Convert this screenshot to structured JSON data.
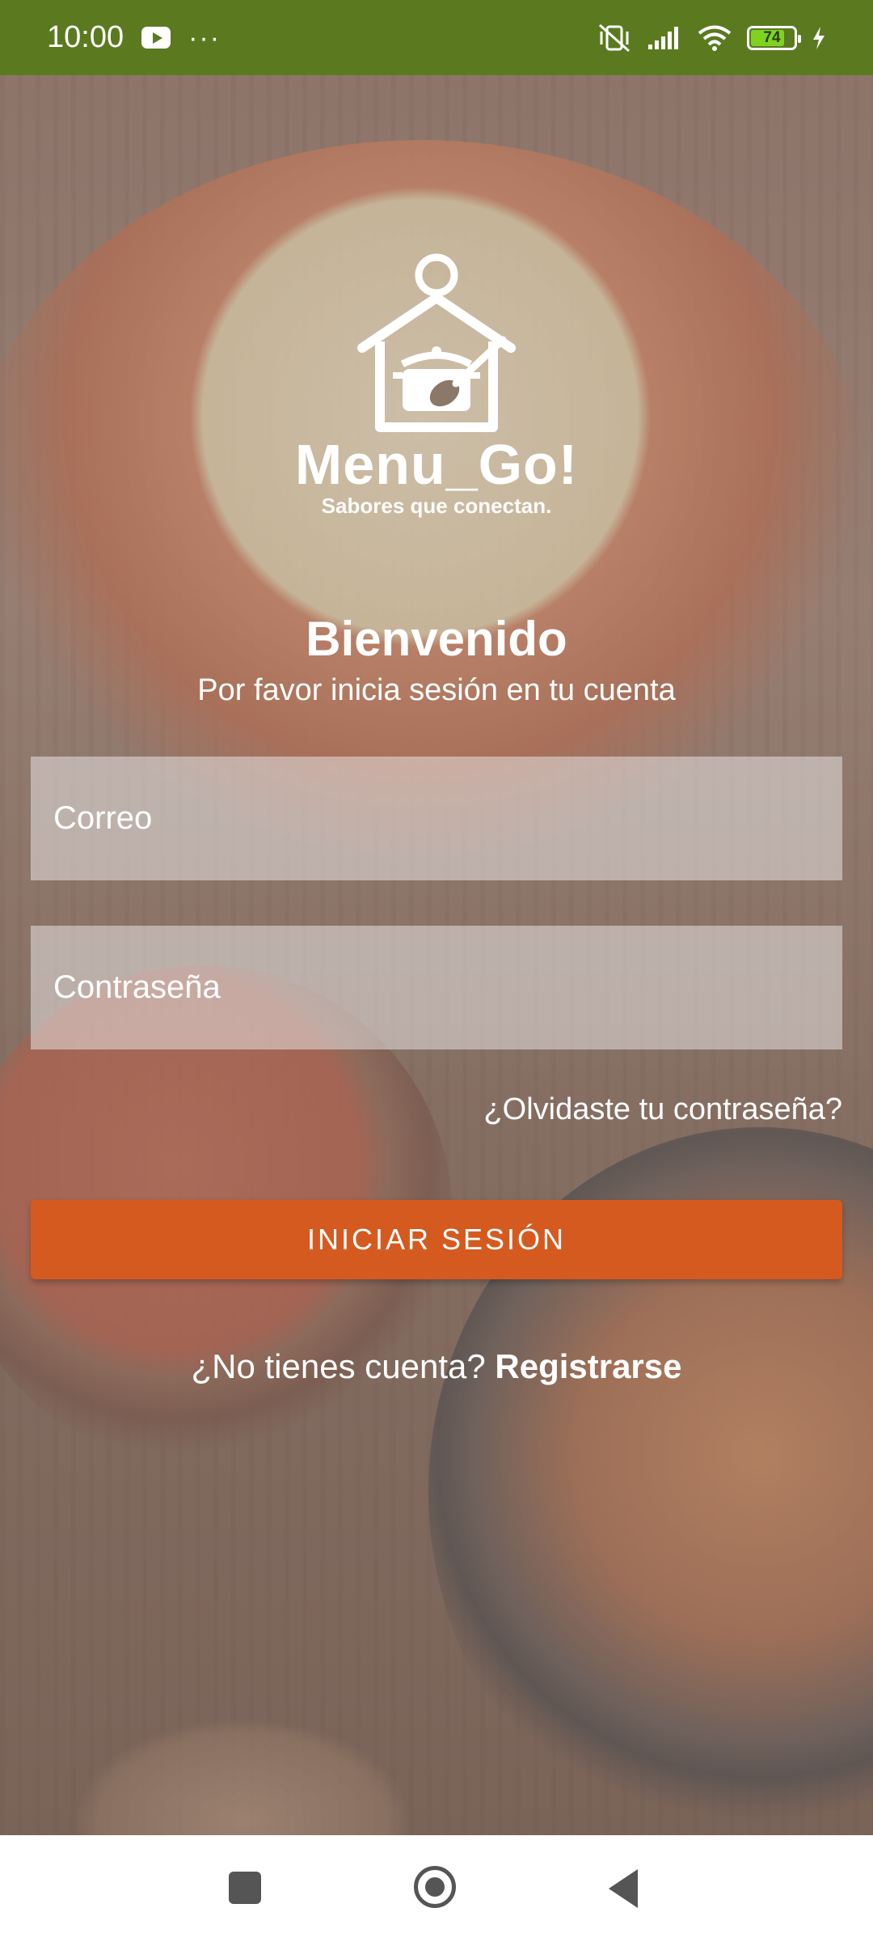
{
  "status_bar": {
    "time": "10:00",
    "battery_level": "74",
    "icons": [
      "youtube-icon",
      "more-dots-icon",
      "vibrate-off-icon",
      "signal-icon",
      "wifi-icon",
      "battery-icon",
      "charging-icon"
    ]
  },
  "logo": {
    "name": "Menu_Go!",
    "tagline": "Sabores que conectan."
  },
  "welcome": {
    "title": "Bienvenido",
    "subtitle": "Por favor inicia sesión en tu cuenta"
  },
  "form": {
    "email_placeholder": "Correo",
    "password_placeholder": "Contraseña",
    "forgot_password": "¿Olvidaste tu contraseña?",
    "login_button": "INICIAR SESIÓN",
    "no_account": "¿No tienes cuenta?",
    "register_link": "Registrarse"
  },
  "colors": {
    "status_bar": "#5b7a20",
    "primary_button": "#d55a1f"
  }
}
